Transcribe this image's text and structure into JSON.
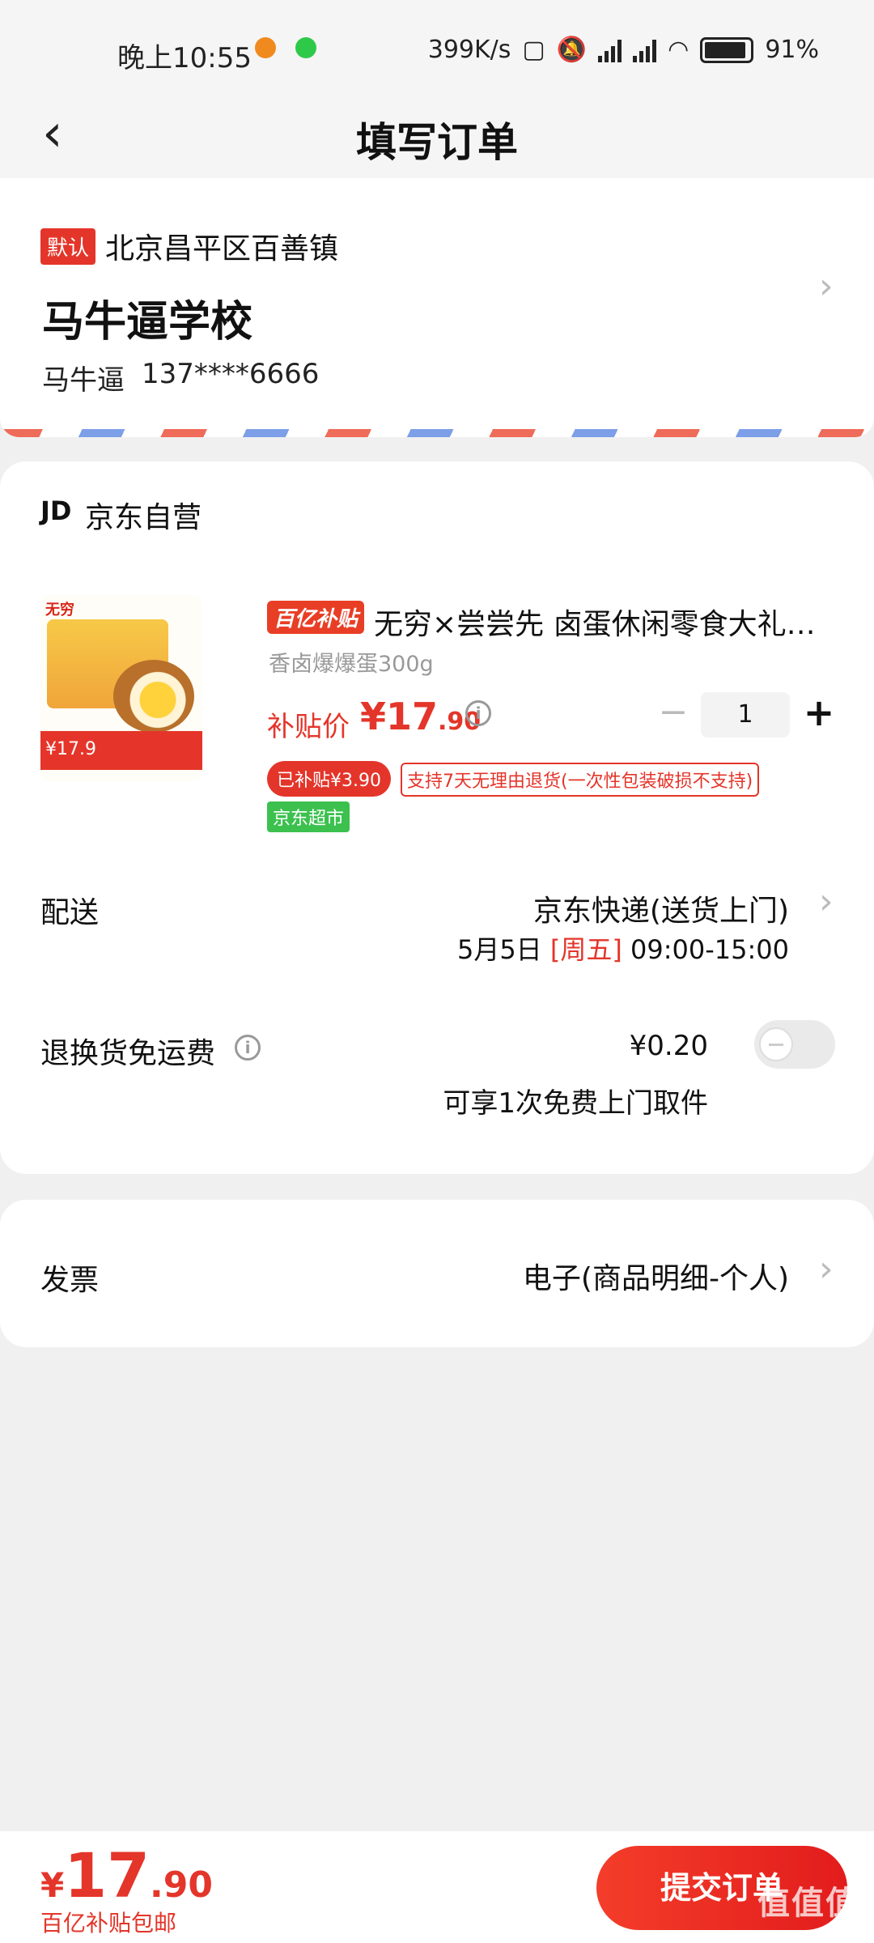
{
  "status_bar": {
    "time": "晚上10:55",
    "network_speed": "399K/s",
    "battery": "91%"
  },
  "header": {
    "title": "填写订单"
  },
  "address": {
    "default_badge": "默认",
    "region": "北京昌平区百善镇",
    "detail": "马牛逼学校",
    "contact_name": "马牛逼",
    "phone": "137****6666"
  },
  "shop": {
    "logo": "JD",
    "name": "京东自营"
  },
  "product": {
    "subsidy_logo": "百亿补贴",
    "title": "无穷×尝尝先 卤蛋休闲零食大礼…",
    "spec": "香卤爆爆蛋300g",
    "image_brand": "无穷",
    "image_price": "¥17.9",
    "price_label": "补贴价",
    "price_integer": "¥17",
    "price_decimal": ".90",
    "quantity": "1",
    "subsidy_tag": "已补贴¥3.90",
    "return_tag": "支持7天无理由退货(一次性包装破损不支持)",
    "market_tag": "京东超市"
  },
  "delivery": {
    "label": "配送",
    "method": "京东快递(送货上门)",
    "date": "5月5日",
    "weekday": "[周五]",
    "time_range": "09:00-15:00"
  },
  "return_fee": {
    "label": "退换货免运费",
    "value": "¥0.20",
    "note": "可享1次免费上门取件",
    "enabled": false
  },
  "invoice": {
    "label": "发票",
    "value": "电子(商品明细-个人)"
  },
  "footer": {
    "currency": "¥",
    "total_integer": "17",
    "total_decimal": ".90",
    "note": "百亿补贴包邮",
    "submit_label": "提交订单",
    "watermark": "值值值"
  },
  "colors": {
    "accent": "#e4352a",
    "market_green": "#3cc14f"
  }
}
